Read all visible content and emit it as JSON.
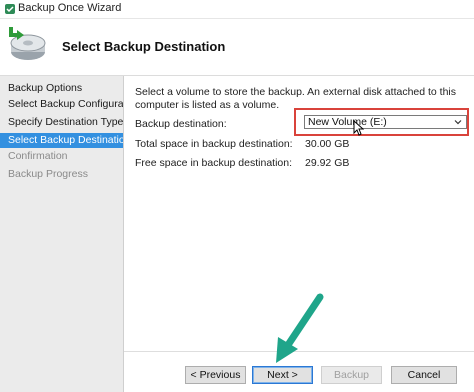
{
  "window": {
    "title": "Backup Once Wizard"
  },
  "header": {
    "heading": "Select Backup Destination"
  },
  "sidebar": {
    "steps": [
      {
        "label": "Backup Options",
        "state": "normal"
      },
      {
        "label": "Select Backup Configurat...",
        "state": "normal"
      },
      {
        "label": "Specify Destination Type",
        "state": "normal"
      },
      {
        "label": "Select Backup Destination",
        "state": "active"
      },
      {
        "label": "Confirmation",
        "state": "disabled"
      },
      {
        "label": "Backup Progress",
        "state": "disabled"
      }
    ]
  },
  "main": {
    "description": "Select a volume to store the backup. An external disk attached to this computer is listed as a volume.",
    "destination_label": "Backup destination:",
    "destination_value": "New Volume (E:)",
    "total_space_label": "Total space in backup destination:",
    "total_space_value": "30.00 GB",
    "free_space_label": "Free space in backup destination:",
    "free_space_value": "29.92 GB"
  },
  "buttons": {
    "previous": "< Previous",
    "next": "Next >",
    "backup": "Backup",
    "cancel": "Cancel"
  },
  "colors": {
    "accent": "#3390e0",
    "highlight_box": "#d9433b",
    "annotation_arrow": "#1fa58a"
  }
}
